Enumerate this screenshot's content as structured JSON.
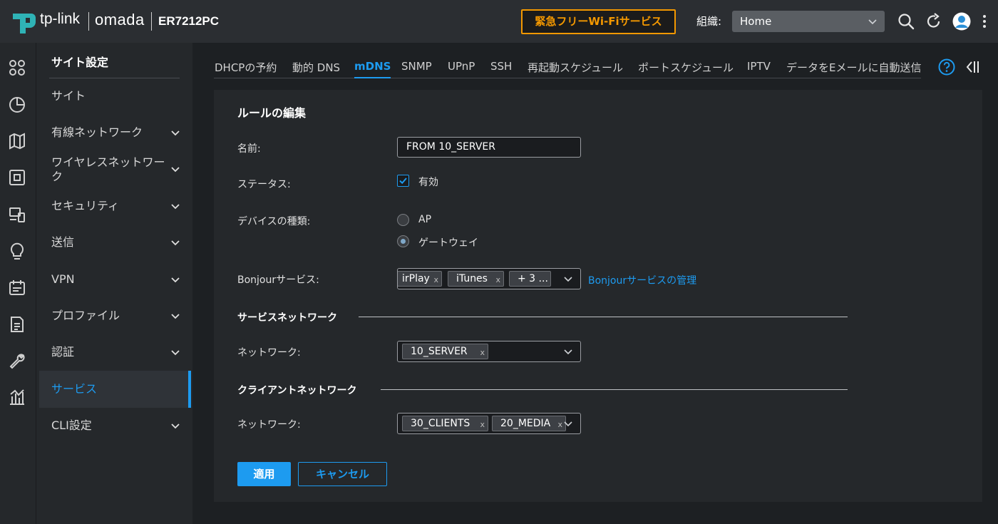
{
  "header": {
    "brand": "tp-link",
    "product": "omada",
    "model": "ER7212PC",
    "emergency_button": "緊急フリーWi-Fiサービス",
    "org_label": "組織:",
    "org_value": "Home"
  },
  "sidebar": {
    "title": "サイト設定",
    "items": [
      {
        "label": "サイト"
      },
      {
        "label": "有線ネットワーク"
      },
      {
        "label": "ワイヤレスネットワーク"
      },
      {
        "label": "セキュリティ"
      },
      {
        "label": "送信"
      },
      {
        "label": "VPN"
      },
      {
        "label": "プロファイル"
      },
      {
        "label": "認証"
      },
      {
        "label": "サービス"
      },
      {
        "label": "CLI設定"
      }
    ],
    "active": "サービス"
  },
  "tabs": [
    {
      "label": "DHCPの予約"
    },
    {
      "label": "動的 DNS"
    },
    {
      "label": "mDNS"
    },
    {
      "label": "SNMP"
    },
    {
      "label": "UPnP"
    },
    {
      "label": "SSH"
    },
    {
      "label": "再起動スケジュール"
    },
    {
      "label": "ポートスケジュール"
    },
    {
      "label": "IPTV"
    },
    {
      "label": "データをEメールに自動送信"
    }
  ],
  "form": {
    "title": "ルールの編集",
    "name_label": "名前:",
    "name_value": "FROM 10_SERVER",
    "status_label": "ステータス:",
    "status_checkbox_label": "有効",
    "status_enabled": true,
    "device_type_label": "デバイスの種類:",
    "device_options": [
      "AP",
      "ゲートウェイ"
    ],
    "device_selected": "ゲートウェイ",
    "bonjour_label": "Bonjourサービス:",
    "bonjour_tags": [
      "irPlay",
      "iTunes",
      "+ 3 ..."
    ],
    "bonjour_link": "Bonjourサービスの管理",
    "service_network_section": "サービスネットワーク",
    "service_network_label": "ネットワーク:",
    "service_network_tags": [
      "10_SERVER"
    ],
    "client_network_section": "クライアントネットワーク",
    "client_network_label": "ネットワーク:",
    "client_network_tags": [
      "30_CLIENTS",
      "20_MEDIA"
    ],
    "tag_remove": "x",
    "apply_button": "適用",
    "cancel_button": "キャンセル"
  },
  "colors": {
    "accent": "#1d9bf0",
    "emergency": "#f39800",
    "background": "#1d2023",
    "panel": "#25282b"
  }
}
